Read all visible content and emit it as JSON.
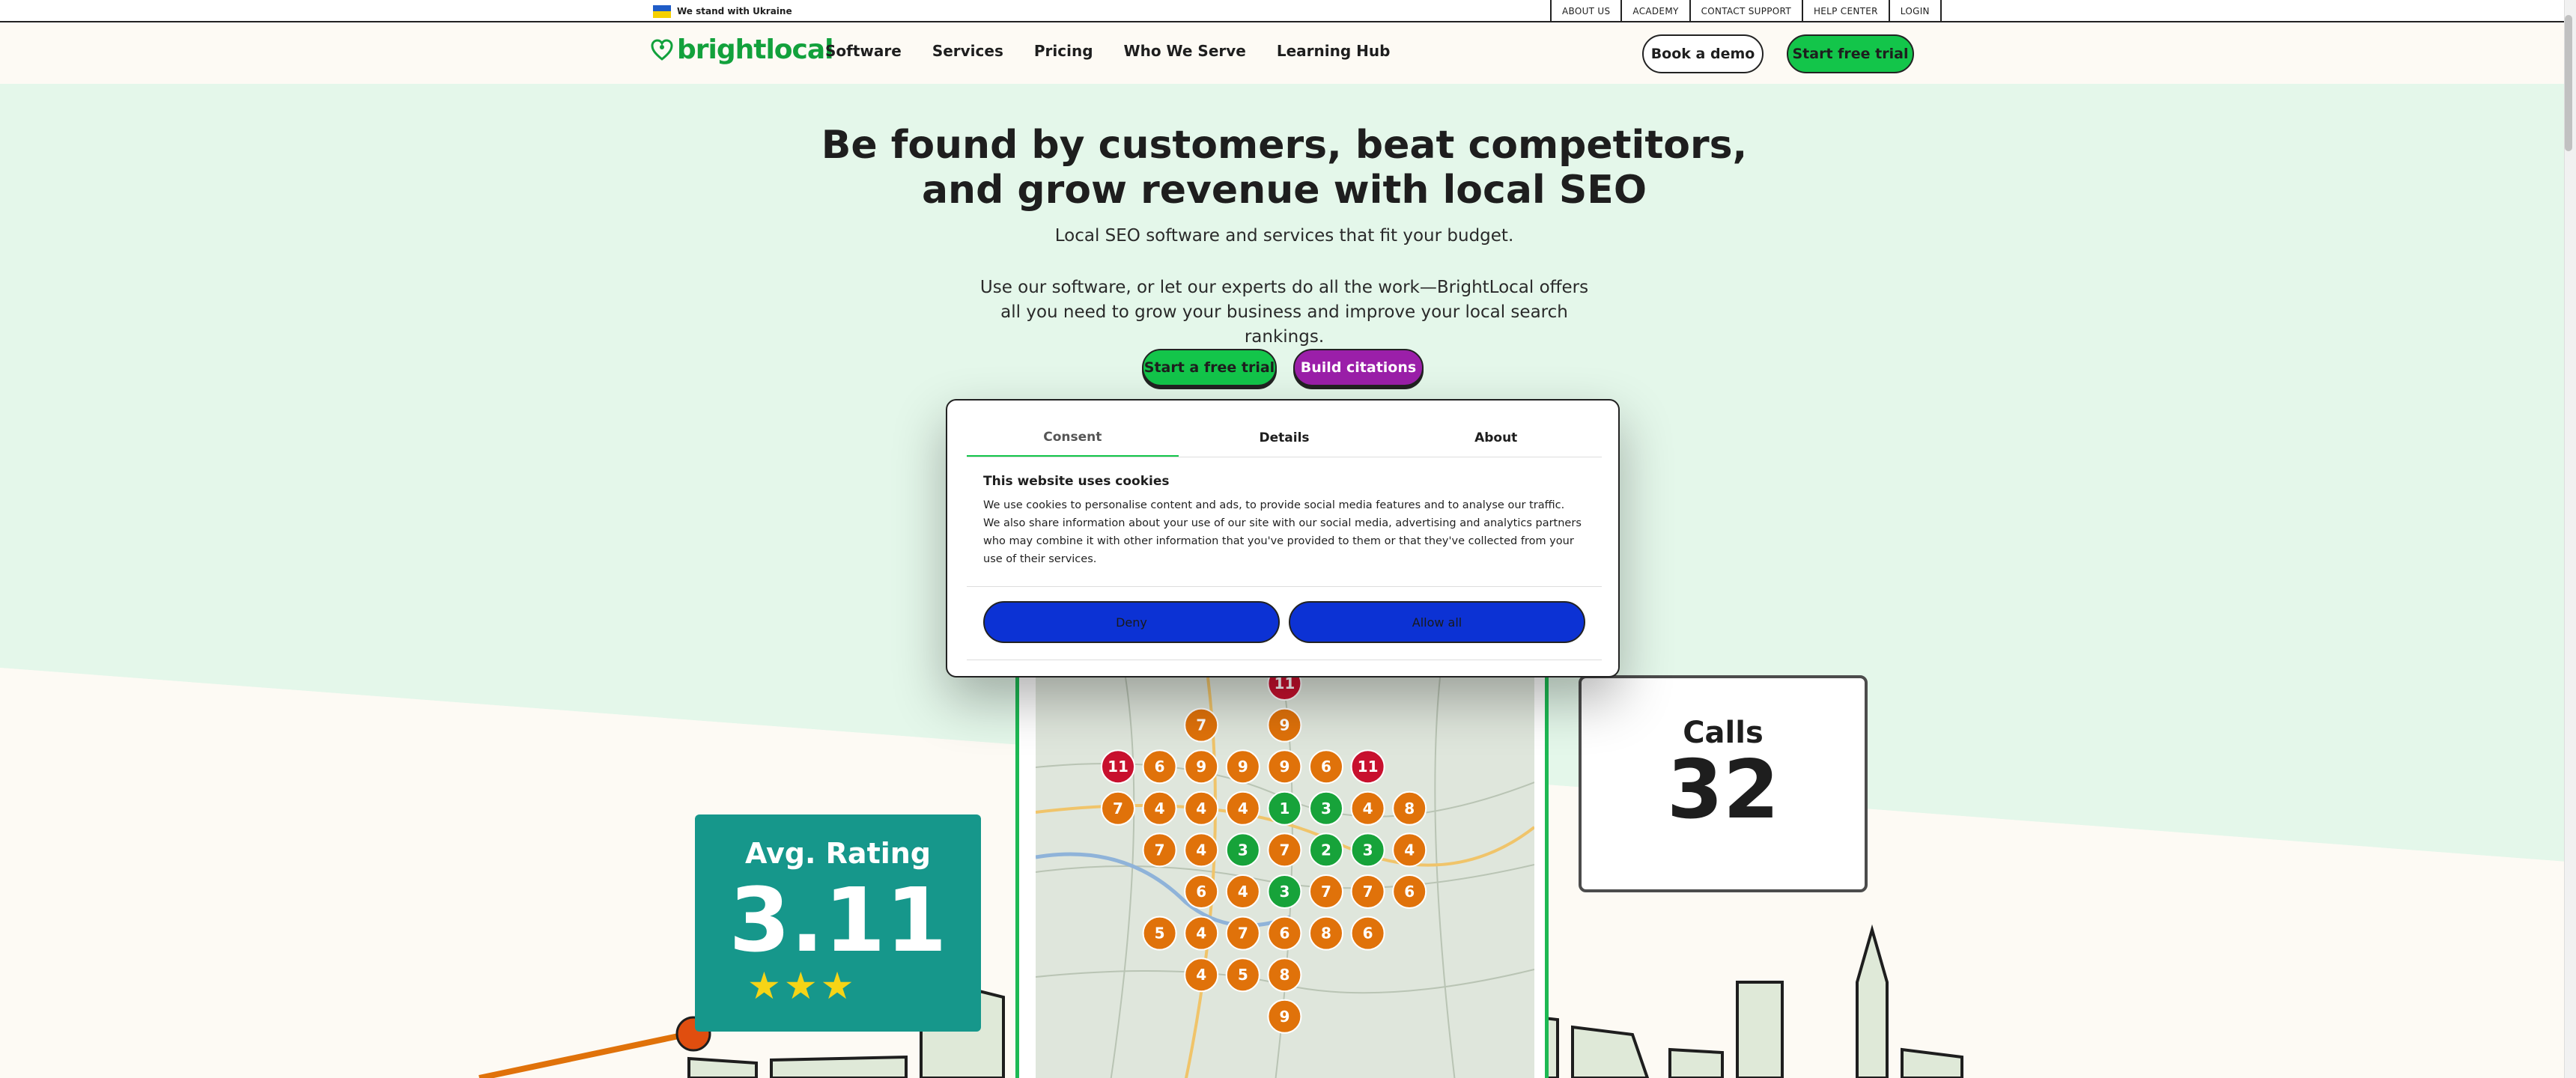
{
  "utility": {
    "ukraine_text": "We stand with Ukraine",
    "links": [
      "ABOUT US",
      "ACADEMY",
      "CONTACT SUPPORT",
      "HELP CENTER",
      "LOGIN"
    ]
  },
  "nav": {
    "logo_text": "brightlocal",
    "menu": [
      "Software",
      "Services",
      "Pricing",
      "Who We Serve",
      "Learning Hub"
    ],
    "demo_label": "Book a demo",
    "trial_label": "Start free trial"
  },
  "hero": {
    "title": "Be found by customers, beat competitors, and grow revenue with local SEO",
    "subtitle": "Local SEO software and services that fit your budget.",
    "body": "Use our software, or let our experts do all the work—BrightLocal offers all you need to grow your business and improve your local search rankings.",
    "cta_trial": "Start a free trial",
    "cta_citations": "Build citations"
  },
  "cards": {
    "rating_label": "Avg. Rating",
    "rating_value": "3.11",
    "stars": "★★★",
    "calls_label": "Calls",
    "calls_value": "32"
  },
  "map": {
    "grid": [
      [
        null,
        null,
        null,
        null,
        11,
        null,
        null
      ],
      [
        null,
        null,
        7,
        null,
        9,
        null,
        null
      ],
      [
        11,
        6,
        9,
        9,
        9,
        6,
        11
      ],
      [
        7,
        4,
        4,
        4,
        1,
        3,
        4,
        8
      ],
      [
        null,
        7,
        4,
        3,
        7,
        2,
        3,
        4
      ],
      [
        null,
        null,
        6,
        4,
        3,
        7,
        7,
        6
      ],
      [
        null,
        5,
        4,
        7,
        6,
        8,
        6,
        null
      ],
      [
        null,
        null,
        4,
        5,
        8,
        null,
        null,
        null
      ],
      [
        null,
        null,
        null,
        null,
        9,
        null,
        null,
        null
      ]
    ],
    "colors": {
      "red": "#c8102e",
      "orange": "#e0720a",
      "green": "#17a33a"
    }
  },
  "cookie": {
    "tabs": [
      "Consent",
      "Details",
      "About"
    ],
    "title": "This website uses cookies",
    "body": "We use cookies to personalise content and ads, to provide social media features and to analyse our traffic. We also share information about your use of our site with our social media, advertising and analytics partners who may combine it with other information that you've provided to them or that they've collected from your use of their services.",
    "deny_label": "Deny",
    "allow_label": "Allow all"
  }
}
